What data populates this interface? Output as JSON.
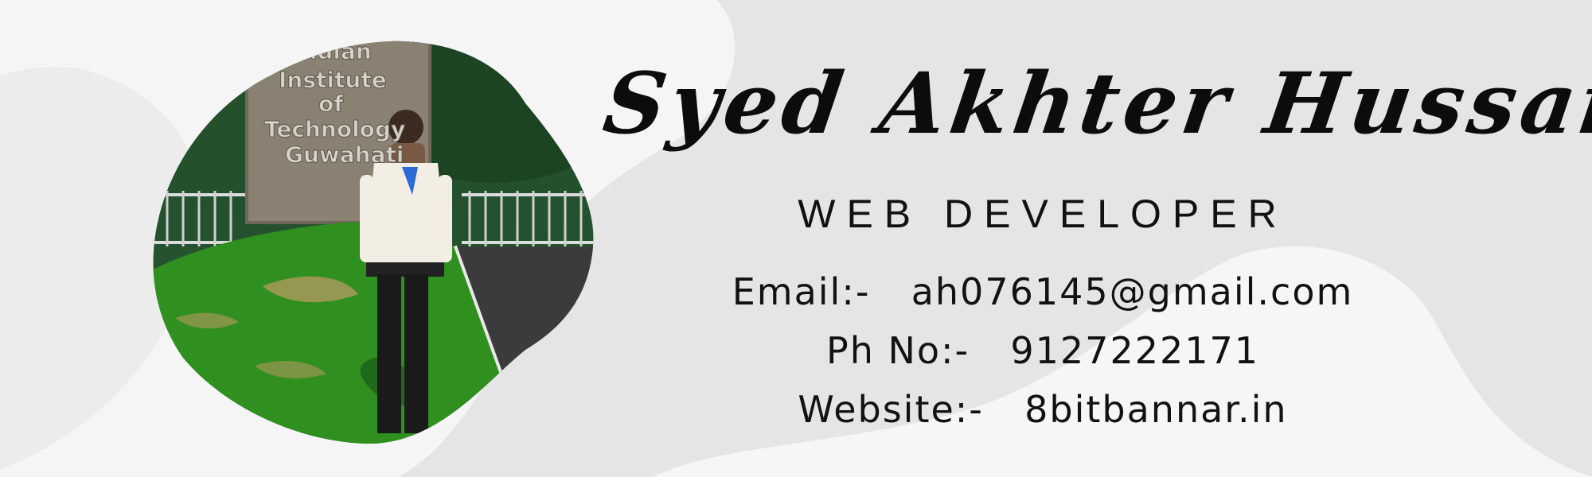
{
  "profile": {
    "name": "Syed Akhter Hussain",
    "role": "WEB DEVELOPER",
    "email_label": "Email:-",
    "email": "ah076145@gmail.com",
    "phone_label": "Ph No:-",
    "phone": "9127222171",
    "website_label": "Website:-",
    "website": "8bitbannar.in"
  },
  "photo": {
    "sign_text": [
      "Indian",
      "Institute",
      "of",
      "Technology",
      "Guwahati"
    ]
  },
  "colors": {
    "background": "#e7e7e7",
    "blob": "#f7f7f7",
    "text": "#111111",
    "grass": "#2f8f1f"
  }
}
